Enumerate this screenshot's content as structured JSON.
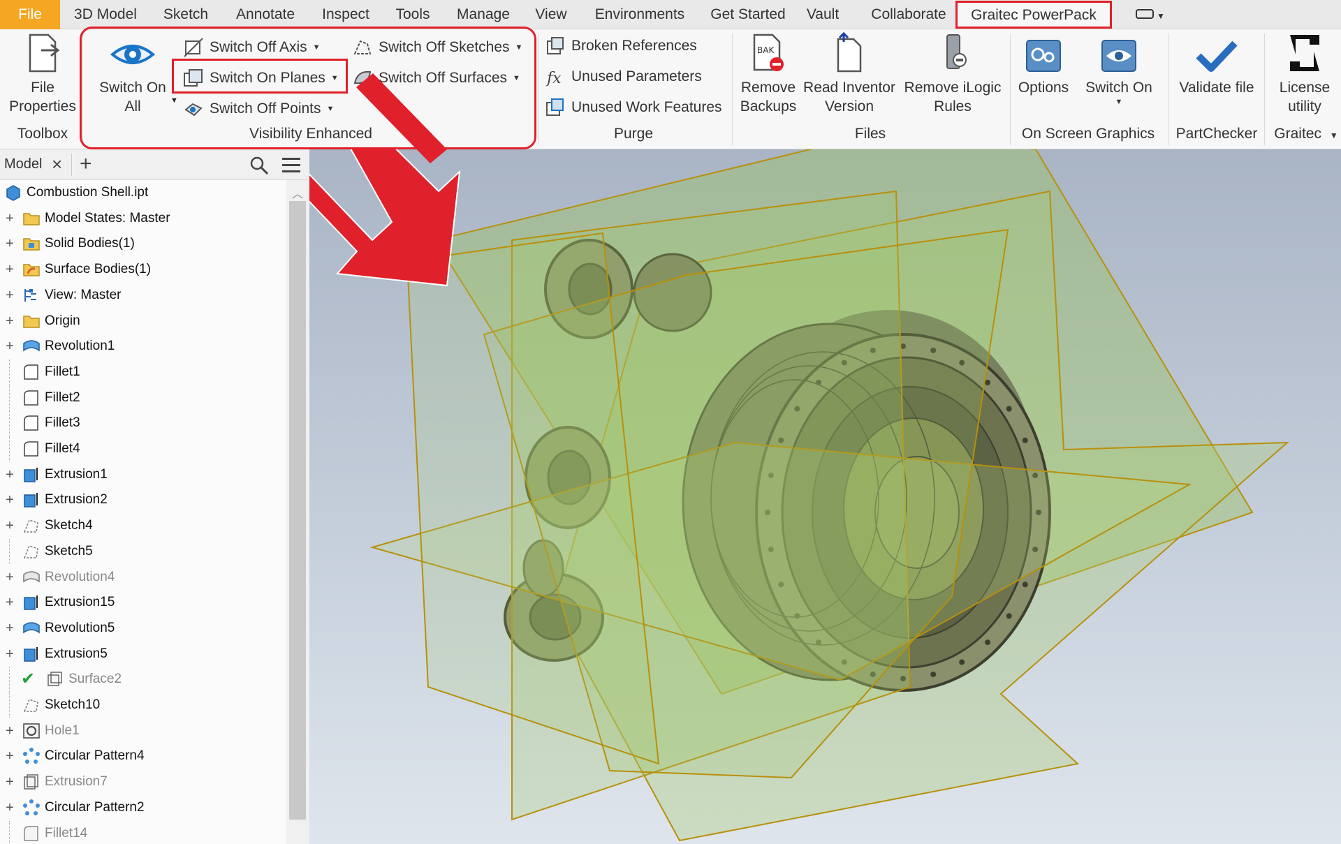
{
  "menubar": {
    "tabs": [
      "File",
      "3D Model",
      "Sketch",
      "Annotate",
      "Inspect",
      "Tools",
      "Manage",
      "View",
      "Environments",
      "Get Started",
      "Vault",
      "Collaborate",
      "Graitec PowerPack"
    ],
    "active_tab": "Graitec PowerPack"
  },
  "ribbon": {
    "toolbox": {
      "file_properties": "File\nProperties",
      "label": "Toolbox"
    },
    "visibility": {
      "switch_on_all": "Switch On\nAll",
      "switch_off_axis": "Switch Off Axis",
      "switch_on_planes": "Switch On Planes",
      "switch_off_points": "Switch Off Points",
      "switch_off_sketches": "Switch Off Sketches",
      "switch_off_surfaces": "Switch Off Surfaces",
      "label": "Visibility Enhanced"
    },
    "purge": {
      "broken_references": "Broken References",
      "unused_parameters": "Unused Parameters",
      "unused_work_features": "Unused Work Features",
      "label": "Purge"
    },
    "files": {
      "remove_backups": "Remove\nBackups",
      "bak_tag": "BAK",
      "read_inventor_version": "Read Inventor\nVersion",
      "remove_ilogic_rules": "Remove iLogic\nRules",
      "label": "Files"
    },
    "on_screen_graphics": {
      "options": "Options",
      "switch_on": "Switch On",
      "label": "On Screen Graphics"
    },
    "partchecker": {
      "validate_file": "Validate file",
      "label": "PartChecker"
    },
    "graitec": {
      "license_utility": "License\nutility",
      "label": "Graitec"
    },
    "accent_color": "#e0202a"
  },
  "browser": {
    "tab_label": "Model",
    "items": [
      {
        "label": "Combustion Shell.ipt",
        "icon": "part-icon",
        "expand": "",
        "dim": false
      },
      {
        "label": "Model States: Master",
        "icon": "folder-icon",
        "expand": "+",
        "dim": false
      },
      {
        "label": "Solid Bodies(1)",
        "icon": "solid-bodies-icon",
        "expand": "+",
        "dim": false
      },
      {
        "label": "Surface Bodies(1)",
        "icon": "surface-bodies-icon",
        "expand": "+",
        "dim": false
      },
      {
        "label": "View: Master",
        "icon": "view-icon",
        "expand": "+",
        "dim": false
      },
      {
        "label": "Origin",
        "icon": "folder-icon",
        "expand": "+",
        "dim": false
      },
      {
        "label": "Revolution1",
        "icon": "revolution-icon",
        "expand": "+",
        "dim": false
      },
      {
        "label": "Fillet1",
        "icon": "fillet-icon",
        "expand": "",
        "dim": false
      },
      {
        "label": "Fillet2",
        "icon": "fillet-icon",
        "expand": "",
        "dim": false
      },
      {
        "label": "Fillet3",
        "icon": "fillet-icon",
        "expand": "",
        "dim": false
      },
      {
        "label": "Fillet4",
        "icon": "fillet-icon",
        "expand": "",
        "dim": false
      },
      {
        "label": "Extrusion1",
        "icon": "extrusion-icon",
        "expand": "+",
        "dim": false
      },
      {
        "label": "Extrusion2",
        "icon": "extrusion-icon",
        "expand": "+",
        "dim": false
      },
      {
        "label": "Sketch4",
        "icon": "sketch-icon",
        "expand": "+",
        "dim": false
      },
      {
        "label": "Sketch5",
        "icon": "sketch-icon",
        "expand": "",
        "dim": false
      },
      {
        "label": "Revolution4",
        "icon": "revolution-off-icon",
        "expand": "+",
        "dim": true
      },
      {
        "label": "Extrusion15",
        "icon": "extrusion-icon",
        "expand": "+",
        "dim": false
      },
      {
        "label": "Revolution5",
        "icon": "revolution-icon",
        "expand": "+",
        "dim": false
      },
      {
        "label": "Extrusion5",
        "icon": "extrusion-icon",
        "expand": "+",
        "dim": false
      },
      {
        "label": "Surface2",
        "icon": "surface-icon",
        "expand": "",
        "dim": true,
        "check": true
      },
      {
        "label": "Sketch10",
        "icon": "sketch-icon",
        "expand": "",
        "dim": false
      },
      {
        "label": "Hole1",
        "icon": "hole-icon",
        "expand": "+",
        "dim": true
      },
      {
        "label": "Circular Pattern4",
        "icon": "circular-pattern-icon",
        "expand": "+",
        "dim": false
      },
      {
        "label": "Extrusion7",
        "icon": "extrusion-off-icon",
        "expand": "+",
        "dim": true
      },
      {
        "label": "Circular Pattern2",
        "icon": "circular-pattern-icon",
        "expand": "+",
        "dim": false
      },
      {
        "label": "Fillet14",
        "icon": "fillet-off-icon",
        "expand": "",
        "dim": true
      }
    ]
  },
  "viewport": {
    "plane_fill": "#9cc266",
    "plane_edge": "#b8900c",
    "annotation_arrow_color": "#e0202a"
  }
}
